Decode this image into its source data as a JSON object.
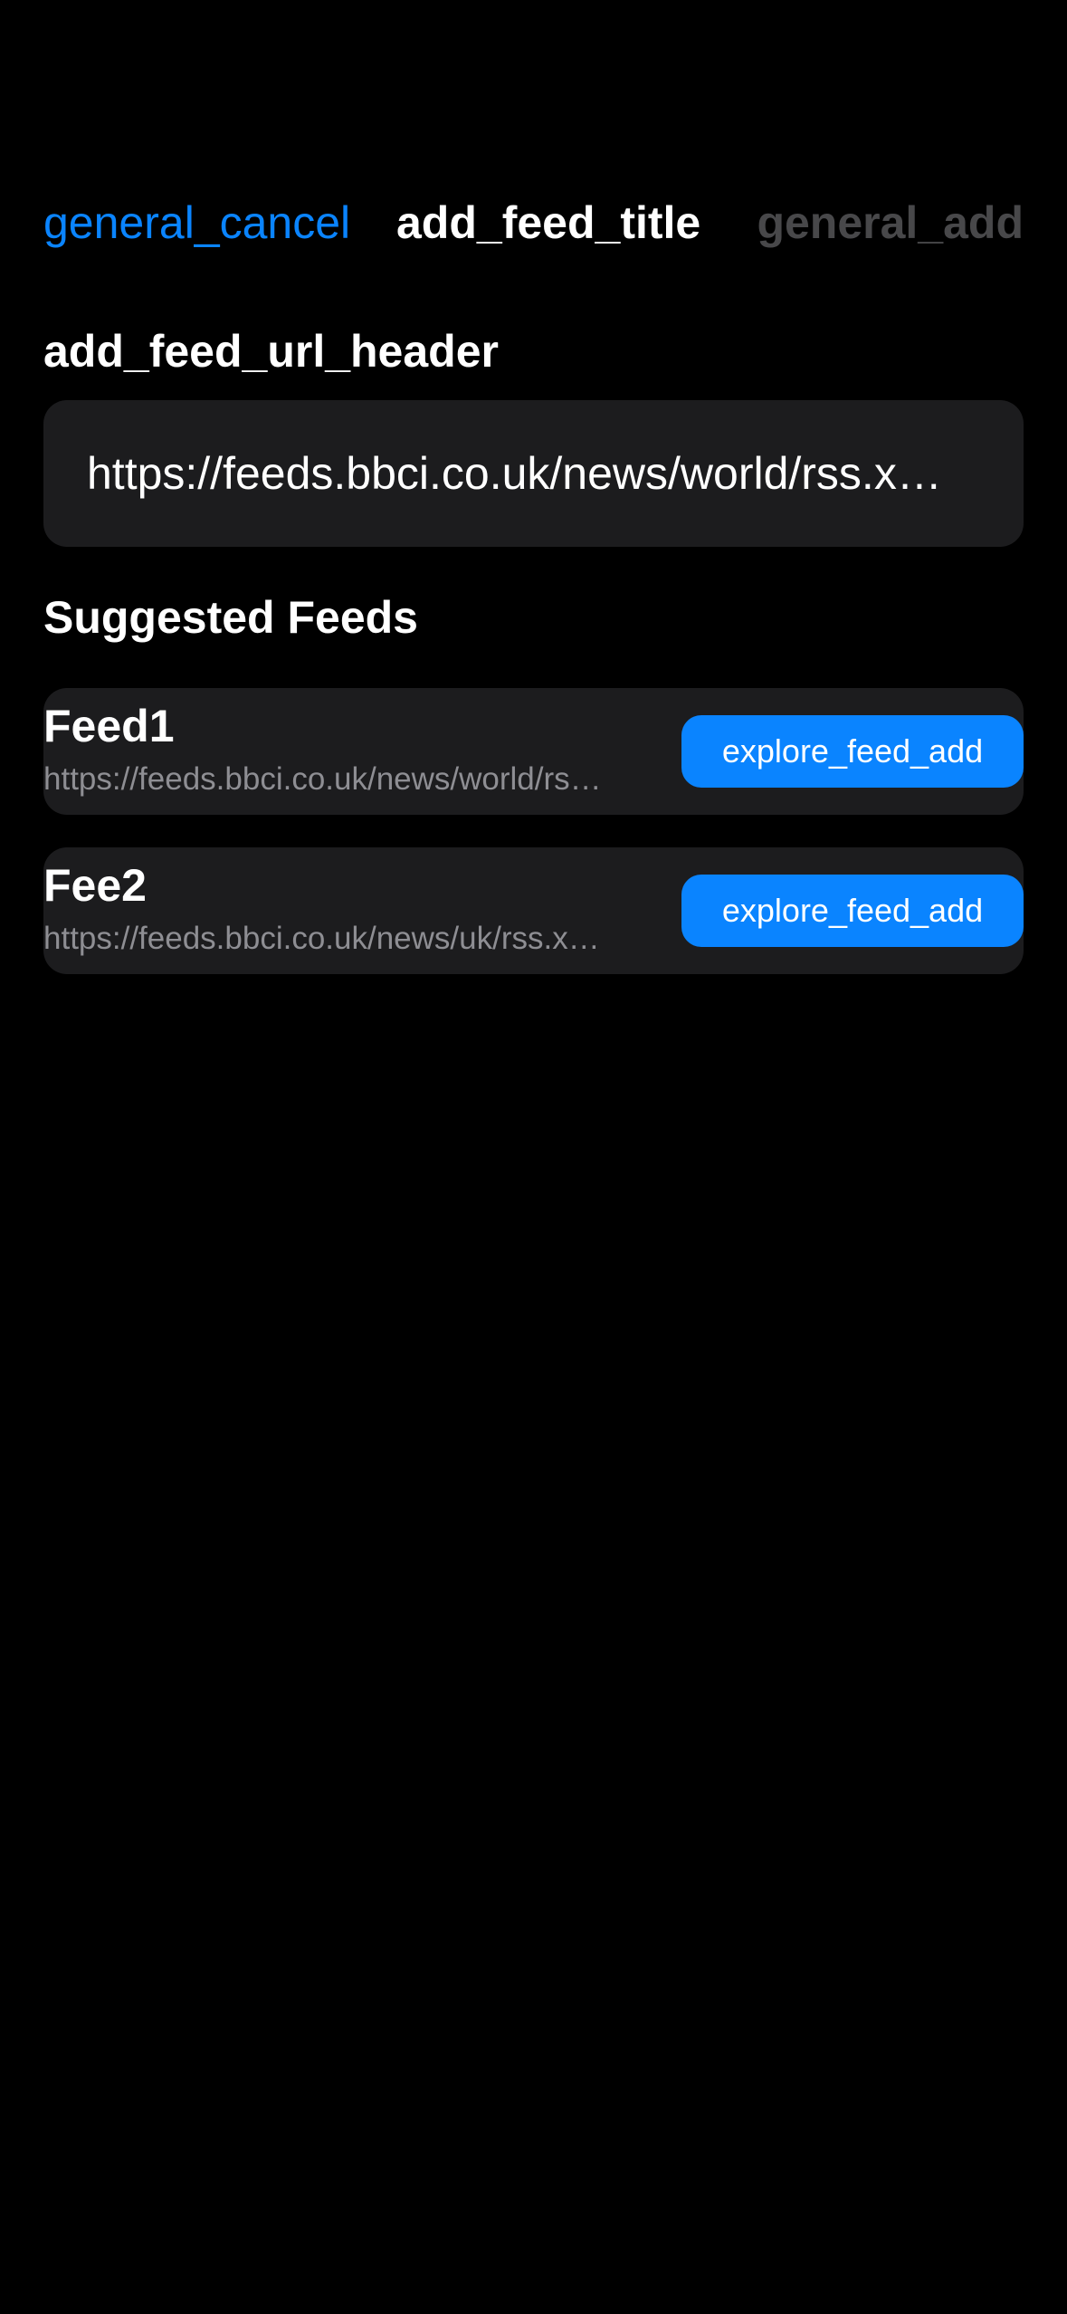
{
  "nav": {
    "cancel_label": "general_cancel",
    "title": "add_feed_title",
    "add_label": "general_add"
  },
  "url_section": {
    "header": "add_feed_url_header",
    "value": "https://feeds.bbci.co.uk/news/world/rss.x…"
  },
  "suggested": {
    "header": "Suggested Feeds",
    "feeds": [
      {
        "name": "Feed1",
        "url": "https://feeds.bbci.co.uk/news/world/rs…",
        "button_label": "explore_feed_add"
      },
      {
        "name": "Fee2",
        "url": "https://feeds.bbci.co.uk/news/uk/rss.x…",
        "button_label": "explore_feed_add"
      }
    ]
  },
  "colors": {
    "background": "#000000",
    "accent": "#0a84ff",
    "card": "#1c1c1e",
    "secondary_text": "#8e8e93",
    "disabled_text": "#48484a"
  }
}
